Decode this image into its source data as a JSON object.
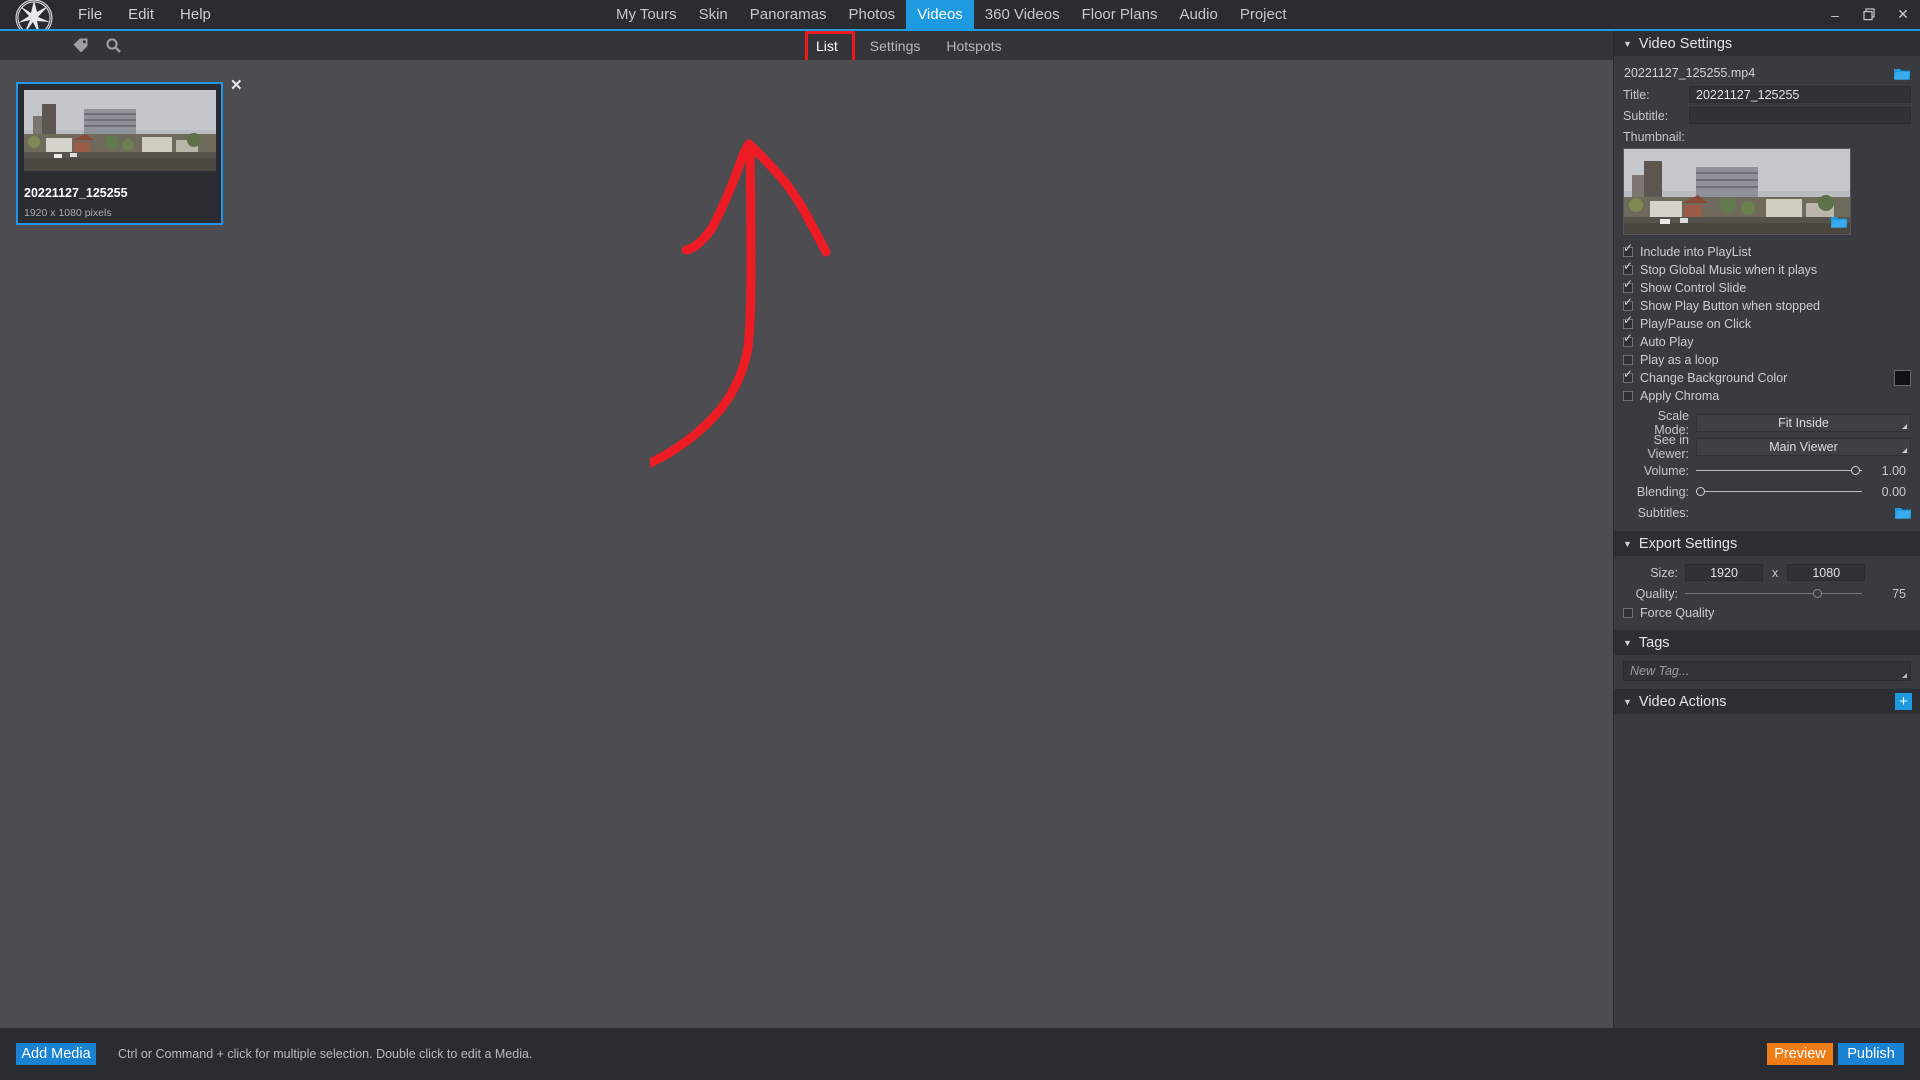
{
  "app": {
    "logo_name": "pano2vr-logo",
    "menus": [
      "File",
      "Edit",
      "Help"
    ],
    "window_controls": {
      "minimize": "–",
      "restore": "❐",
      "close": "✕"
    }
  },
  "main_tabs": [
    {
      "label": "My Tours",
      "active": false
    },
    {
      "label": "Skin",
      "active": false
    },
    {
      "label": "Panoramas",
      "active": false
    },
    {
      "label": "Photos",
      "active": false
    },
    {
      "label": "Videos",
      "active": true
    },
    {
      "label": "360 Videos",
      "active": false
    },
    {
      "label": "Floor Plans",
      "active": false
    },
    {
      "label": "Audio",
      "active": false
    },
    {
      "label": "Project",
      "active": false
    }
  ],
  "subbar": {
    "icons": [
      "tag-icon",
      "search-icon"
    ],
    "tabs": [
      {
        "label": "List",
        "active": true,
        "annotated": true
      },
      {
        "label": "Settings",
        "active": false,
        "annotated": false
      },
      {
        "label": "Hotspots",
        "active": false,
        "annotated": false
      }
    ]
  },
  "media_list": {
    "items": [
      {
        "name": "20221127_125255",
        "meta": "1920 x 1080 pixels",
        "selected": true,
        "close_label": "✕"
      }
    ]
  },
  "annotation": {
    "type": "freehand-arrow",
    "color": "#ed1c24",
    "description": "hand-drawn red arrow pointing up to the List tab"
  },
  "right_panel": {
    "video_settings": {
      "section_title": "Video Settings",
      "caret": "▼",
      "file_name": "20221127_125255.mp4",
      "file_browse_icon": "folder-icon",
      "title_label": "Title:",
      "title_value": "20221127_125255",
      "subtitle_label": "Subtitle:",
      "subtitle_value": "",
      "thumbnail_label": "Thumbnail:",
      "thumbnail_browse_icon": "folder-icon",
      "checkboxes": [
        {
          "label": "Include into PlayList",
          "checked": true
        },
        {
          "label": "Stop Global Music when it plays",
          "checked": true
        },
        {
          "label": "Show Control Slide",
          "checked": true
        },
        {
          "label": "Show Play Button when stopped",
          "checked": true
        },
        {
          "label": "Play/Pause on Click",
          "checked": true
        },
        {
          "label": "Auto Play",
          "checked": true
        },
        {
          "label": "Play as a loop",
          "checked": false
        },
        {
          "label": "Change Background Color",
          "checked": true,
          "swatch": "#111216"
        },
        {
          "label": "Apply Chroma",
          "checked": false
        }
      ],
      "scale_mode_label": "Scale Mode:",
      "scale_mode_value": "Fit Inside",
      "see_in_viewer_label": "See in Viewer:",
      "see_in_viewer_value": "Main Viewer",
      "volume_label": "Volume:",
      "volume_value": "1.00",
      "volume_percent": 100,
      "blending_label": "Blending:",
      "blending_value": "0.00",
      "blending_percent": 0,
      "subtitles_label": "Subtitles:",
      "subtitles_browse_icon": "folder-icon"
    },
    "export_settings": {
      "section_title": "Export Settings",
      "caret": "▼",
      "size_label": "Size:",
      "size_width": "1920",
      "size_x": "x",
      "size_height": "1080",
      "quality_label": "Quality:",
      "quality_value": "75",
      "quality_percent": 75,
      "force_quality_label": "Force Quality",
      "force_quality_checked": false
    },
    "tags": {
      "section_title": "Tags",
      "caret": "▼",
      "new_tag_placeholder": "New Tag..."
    },
    "video_actions": {
      "section_title": "Video Actions",
      "caret": "▼",
      "add_label": "+"
    }
  },
  "status_bar": {
    "add_media_label": "Add Media",
    "hint": "Ctrl or Command + click for multiple selection. Double click to edit a Media.",
    "preview_label": "Preview",
    "publish_label": "Publish"
  },
  "colors": {
    "accent_blue": "#1e9ae0",
    "preview_orange": "#ef7d17",
    "annotation_red": "#ed1c24",
    "panel_bg": "#3a3b40",
    "canvas_bg": "#4c4c51",
    "chrome_bg": "#2b2c31"
  }
}
